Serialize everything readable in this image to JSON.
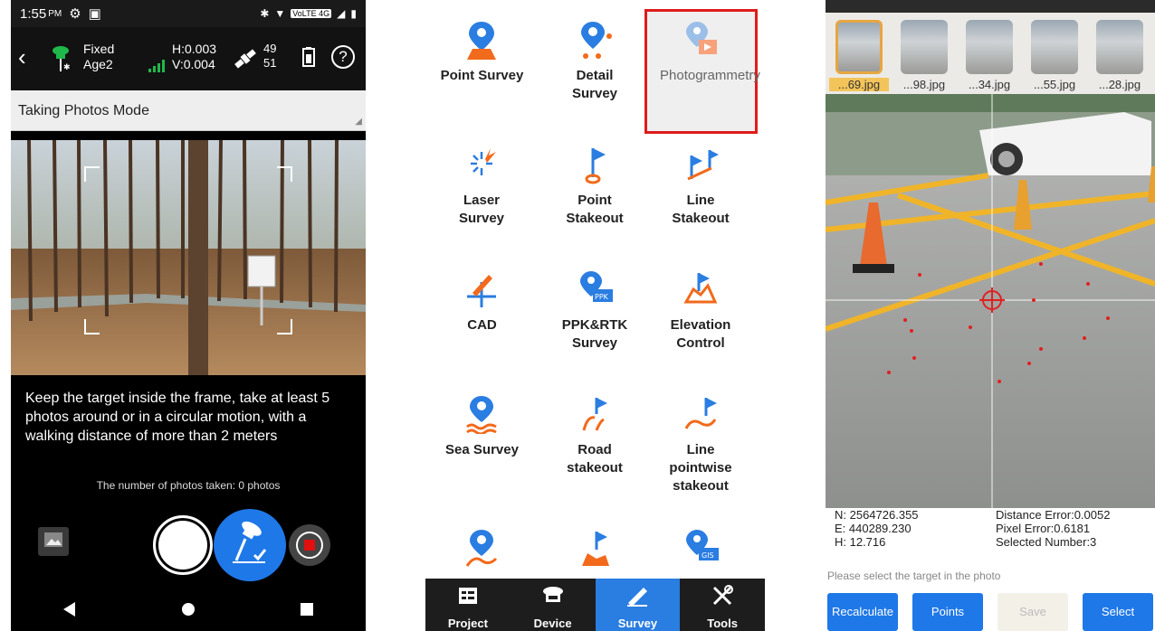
{
  "panel1": {
    "status_bar": {
      "time": "1:55",
      "ampm": "PM",
      "network": "VoLTE 4G"
    },
    "header": {
      "fix_status": "Fixed",
      "age": "Age2",
      "h_precision": "H:0.003",
      "v_precision": "V:0.004",
      "sat_used": "49",
      "sat_visible": "51",
      "help_label": "?"
    },
    "mode_label": "Taking Photos Mode",
    "hint_text": "Keep the target inside the frame, take at least 5 photos around or in a circular motion, with a walking distance of more than 2 meters",
    "photo_count_text": "The number of photos taken: 0 photos"
  },
  "panel2": {
    "menu_items": [
      {
        "label": "Point Survey",
        "icon": "point-survey-icon"
      },
      {
        "label": "Detail Survey",
        "icon": "detail-survey-icon"
      },
      {
        "label": "Photogrammetry",
        "icon": "photogrammetry-icon",
        "selected": true
      },
      {
        "label": "Laser Survey",
        "icon": "laser-survey-icon"
      },
      {
        "label": "Point Stakeout",
        "icon": "point-stakeout-icon"
      },
      {
        "label": "Line Stakeout",
        "icon": "line-stakeout-icon"
      },
      {
        "label": "CAD",
        "icon": "cad-icon"
      },
      {
        "label": "PPK&RTK Survey",
        "icon": "ppk-rtk-icon"
      },
      {
        "label": "Elevation Control",
        "icon": "elevation-control-icon"
      },
      {
        "label": "Sea Survey",
        "icon": "sea-survey-icon"
      },
      {
        "label": "Road stakeout",
        "icon": "road-stakeout-icon"
      },
      {
        "label": "Line pointwise stakeout",
        "icon": "line-pointwise-icon"
      }
    ],
    "tabs": [
      {
        "label": "Project",
        "icon": "project-icon"
      },
      {
        "label": "Device",
        "icon": "device-icon"
      },
      {
        "label": "Survey",
        "icon": "survey-icon",
        "active": true
      },
      {
        "label": "Tools",
        "icon": "tools-icon"
      }
    ],
    "colors": {
      "primary": "#2a7de1",
      "accent": "#f26a1b",
      "selected_border": "#e01b1b"
    }
  },
  "panel3": {
    "thumbnails": [
      "...69.jpg",
      "...98.jpg",
      "...34.jpg",
      "...55.jpg",
      "...28.jpg"
    ],
    "coordinates": {
      "n": "N: 2564726.355",
      "e": "E: 440289.230",
      "h": "H: 12.716"
    },
    "errors": {
      "distance": "Distance Error:0.0052",
      "pixel": "Pixel Error:0.6181",
      "selected": "Selected Number:3"
    },
    "prompt": "Please select the target in the photo",
    "buttons": {
      "recalculate": "Recalculate",
      "points": "Points",
      "save": "Save",
      "select": "Select"
    }
  }
}
